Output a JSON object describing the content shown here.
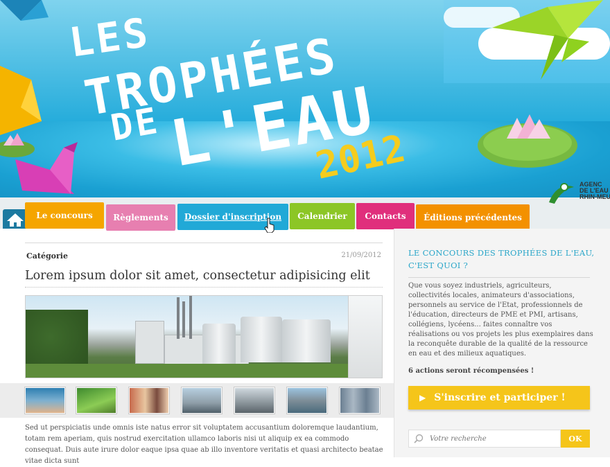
{
  "header": {
    "title_line1": "LES",
    "title_line2": "TROPHÉES",
    "title_line3": "DE",
    "title_line4": "L'EAU",
    "year": "2012",
    "logo_text": "AGENC\nDE L'EAU\nRHIN-MEUS"
  },
  "nav": {
    "home_icon": "home-icon",
    "items": [
      {
        "label": "Le concours",
        "color": "#f5a500"
      },
      {
        "label": "Règlements",
        "color": "#e77fb0"
      },
      {
        "label": "Dossier d'inscription",
        "color": "#21a9d7"
      },
      {
        "label": "Calendrier",
        "color": "#8cc626"
      },
      {
        "label": "Contacts",
        "color": "#e02f7c"
      },
      {
        "label": "Éditions précédentes",
        "color": "#f39100"
      }
    ]
  },
  "article": {
    "category": "Catégorie",
    "date": "21/09/2012",
    "headline": "Lorem ipsum dolor sit amet, consectetur adipisicing elit",
    "body": "Sed ut perspiciatis unde omnis iste natus error sit voluptatem accusantium doloremque laudantium, totam rem aperiam, quis nostrud exercitation ullamco laboris nisi ut aliquip ex ea commodo consequat. Duis aute irure dolor eaque ipsa quae ab illo inventore veritatis et quasi architecto beatae vitae dicta sunt"
  },
  "sidebar": {
    "title": "LE CONCOURS DES TROPHÉES DE L'EAU, C'EST QUOI ?",
    "text": "Que vous soyez industriels, agriculteurs, collectivités locales, animateurs d'associations, personnels au service de l'Etat, professionnels de l'éducation, directeurs de PME et PMI, artisans, collégiens, lycéens... faites connaître vos réalisations ou vos projets les plus exemplaires dans la reconquête durable de la qualité de la ressource en eau et des milieux aquatiques.",
    "highlight": "6 actions seront récompensées !",
    "cta_label": "S'inscrire et participer !",
    "search_placeholder": "Votre recherche",
    "ok_label": "OK"
  },
  "colors": {
    "accent_blue": "#2aa6c9",
    "accent_yellow": "#f5c51a"
  }
}
